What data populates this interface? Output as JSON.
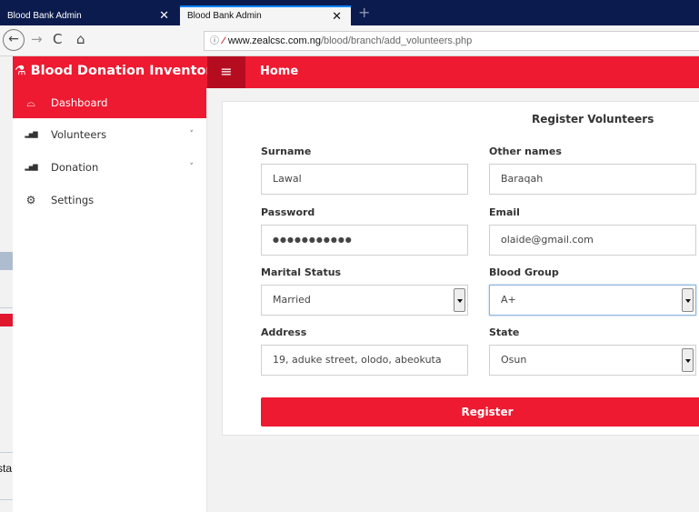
{
  "browser": {
    "tabs": [
      {
        "title": "Blood Bank Admin",
        "close": "✕"
      },
      {
        "title": "Blood Bank Admin",
        "close": "✕"
      }
    ],
    "new_tab": "+",
    "nav": {
      "back": "←",
      "forward": "→",
      "reload": "C",
      "home": "⌂"
    },
    "url": {
      "info": "ⓘ",
      "host": "www.zealcsc.com.ng",
      "path": "/blood/branch/add_volunteers.php"
    }
  },
  "leftover": {
    "text": "sta"
  },
  "app": {
    "brand": "Blood Donation Inventory",
    "brand_icon": "⚗",
    "menu_icon": "≡",
    "topbar_title": "Home",
    "accent": "#ee1a31"
  },
  "sidebar": {
    "items": [
      {
        "label": "Dashboard",
        "icon": "gauge-icon",
        "glyph": "⌓",
        "active": true
      },
      {
        "label": "Volunteers",
        "icon": "bar-chart-icon",
        "glyph": "▂▅▇",
        "chevron": "˅"
      },
      {
        "label": "Donation",
        "icon": "bar-chart-icon",
        "glyph": "▂▅▇",
        "chevron": "˅"
      },
      {
        "label": "Settings",
        "icon": "gear-icon",
        "glyph": "⚙"
      }
    ]
  },
  "form": {
    "title": "Register Volunteers",
    "surname": {
      "label": "Surname",
      "value": "Lawal"
    },
    "other_names": {
      "label": "Other names",
      "value": "Baraqah"
    },
    "password": {
      "label": "Password",
      "value": "●●●●●●●●●●●"
    },
    "email": {
      "label": "Email",
      "value": "olaide@gmail.com"
    },
    "marital_status": {
      "label": "Marital Status",
      "value": "Married"
    },
    "blood_group": {
      "label": "Blood Group",
      "value": "A+"
    },
    "address": {
      "label": "Address",
      "value": "19, aduke street, olodo, abeokuta"
    },
    "state": {
      "label": "State",
      "value": "Osun"
    },
    "submit": "Register"
  }
}
